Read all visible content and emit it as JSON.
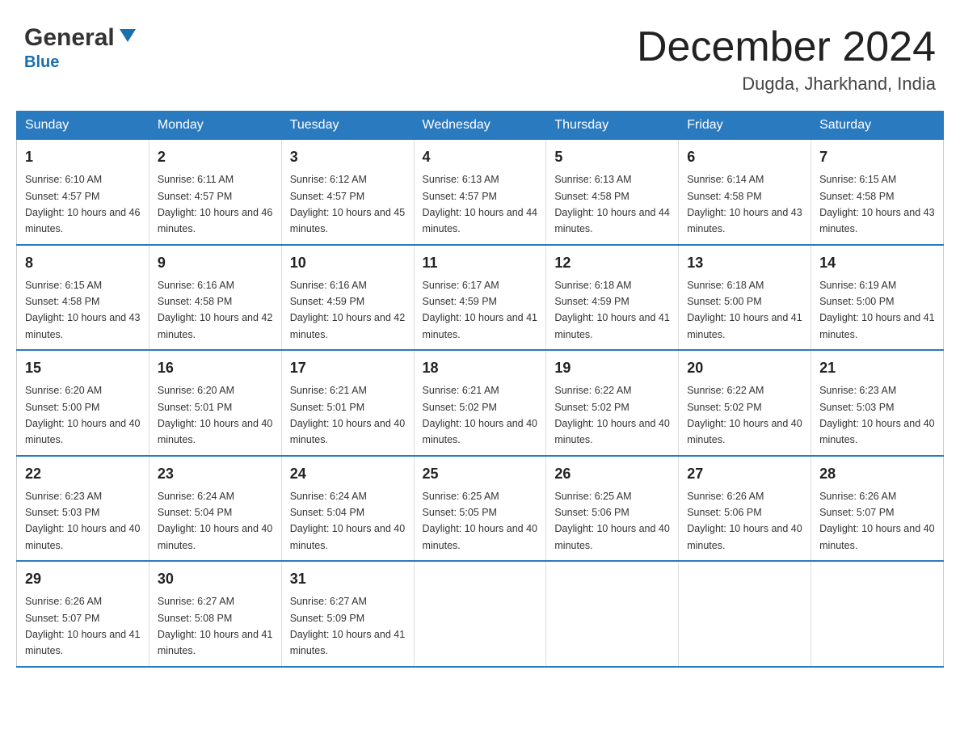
{
  "logo": {
    "general": "General",
    "blue": "Blue"
  },
  "header": {
    "month": "December 2024",
    "location": "Dugda, Jharkhand, India"
  },
  "days_of_week": [
    "Sunday",
    "Monday",
    "Tuesday",
    "Wednesday",
    "Thursday",
    "Friday",
    "Saturday"
  ],
  "weeks": [
    [
      {
        "day": "1",
        "sunrise": "Sunrise: 6:10 AM",
        "sunset": "Sunset: 4:57 PM",
        "daylight": "Daylight: 10 hours and 46 minutes."
      },
      {
        "day": "2",
        "sunrise": "Sunrise: 6:11 AM",
        "sunset": "Sunset: 4:57 PM",
        "daylight": "Daylight: 10 hours and 46 minutes."
      },
      {
        "day": "3",
        "sunrise": "Sunrise: 6:12 AM",
        "sunset": "Sunset: 4:57 PM",
        "daylight": "Daylight: 10 hours and 45 minutes."
      },
      {
        "day": "4",
        "sunrise": "Sunrise: 6:13 AM",
        "sunset": "Sunset: 4:57 PM",
        "daylight": "Daylight: 10 hours and 44 minutes."
      },
      {
        "day": "5",
        "sunrise": "Sunrise: 6:13 AM",
        "sunset": "Sunset: 4:58 PM",
        "daylight": "Daylight: 10 hours and 44 minutes."
      },
      {
        "day": "6",
        "sunrise": "Sunrise: 6:14 AM",
        "sunset": "Sunset: 4:58 PM",
        "daylight": "Daylight: 10 hours and 43 minutes."
      },
      {
        "day": "7",
        "sunrise": "Sunrise: 6:15 AM",
        "sunset": "Sunset: 4:58 PM",
        "daylight": "Daylight: 10 hours and 43 minutes."
      }
    ],
    [
      {
        "day": "8",
        "sunrise": "Sunrise: 6:15 AM",
        "sunset": "Sunset: 4:58 PM",
        "daylight": "Daylight: 10 hours and 43 minutes."
      },
      {
        "day": "9",
        "sunrise": "Sunrise: 6:16 AM",
        "sunset": "Sunset: 4:58 PM",
        "daylight": "Daylight: 10 hours and 42 minutes."
      },
      {
        "day": "10",
        "sunrise": "Sunrise: 6:16 AM",
        "sunset": "Sunset: 4:59 PM",
        "daylight": "Daylight: 10 hours and 42 minutes."
      },
      {
        "day": "11",
        "sunrise": "Sunrise: 6:17 AM",
        "sunset": "Sunset: 4:59 PM",
        "daylight": "Daylight: 10 hours and 41 minutes."
      },
      {
        "day": "12",
        "sunrise": "Sunrise: 6:18 AM",
        "sunset": "Sunset: 4:59 PM",
        "daylight": "Daylight: 10 hours and 41 minutes."
      },
      {
        "day": "13",
        "sunrise": "Sunrise: 6:18 AM",
        "sunset": "Sunset: 5:00 PM",
        "daylight": "Daylight: 10 hours and 41 minutes."
      },
      {
        "day": "14",
        "sunrise": "Sunrise: 6:19 AM",
        "sunset": "Sunset: 5:00 PM",
        "daylight": "Daylight: 10 hours and 41 minutes."
      }
    ],
    [
      {
        "day": "15",
        "sunrise": "Sunrise: 6:20 AM",
        "sunset": "Sunset: 5:00 PM",
        "daylight": "Daylight: 10 hours and 40 minutes."
      },
      {
        "day": "16",
        "sunrise": "Sunrise: 6:20 AM",
        "sunset": "Sunset: 5:01 PM",
        "daylight": "Daylight: 10 hours and 40 minutes."
      },
      {
        "day": "17",
        "sunrise": "Sunrise: 6:21 AM",
        "sunset": "Sunset: 5:01 PM",
        "daylight": "Daylight: 10 hours and 40 minutes."
      },
      {
        "day": "18",
        "sunrise": "Sunrise: 6:21 AM",
        "sunset": "Sunset: 5:02 PM",
        "daylight": "Daylight: 10 hours and 40 minutes."
      },
      {
        "day": "19",
        "sunrise": "Sunrise: 6:22 AM",
        "sunset": "Sunset: 5:02 PM",
        "daylight": "Daylight: 10 hours and 40 minutes."
      },
      {
        "day": "20",
        "sunrise": "Sunrise: 6:22 AM",
        "sunset": "Sunset: 5:02 PM",
        "daylight": "Daylight: 10 hours and 40 minutes."
      },
      {
        "day": "21",
        "sunrise": "Sunrise: 6:23 AM",
        "sunset": "Sunset: 5:03 PM",
        "daylight": "Daylight: 10 hours and 40 minutes."
      }
    ],
    [
      {
        "day": "22",
        "sunrise": "Sunrise: 6:23 AM",
        "sunset": "Sunset: 5:03 PM",
        "daylight": "Daylight: 10 hours and 40 minutes."
      },
      {
        "day": "23",
        "sunrise": "Sunrise: 6:24 AM",
        "sunset": "Sunset: 5:04 PM",
        "daylight": "Daylight: 10 hours and 40 minutes."
      },
      {
        "day": "24",
        "sunrise": "Sunrise: 6:24 AM",
        "sunset": "Sunset: 5:04 PM",
        "daylight": "Daylight: 10 hours and 40 minutes."
      },
      {
        "day": "25",
        "sunrise": "Sunrise: 6:25 AM",
        "sunset": "Sunset: 5:05 PM",
        "daylight": "Daylight: 10 hours and 40 minutes."
      },
      {
        "day": "26",
        "sunrise": "Sunrise: 6:25 AM",
        "sunset": "Sunset: 5:06 PM",
        "daylight": "Daylight: 10 hours and 40 minutes."
      },
      {
        "day": "27",
        "sunrise": "Sunrise: 6:26 AM",
        "sunset": "Sunset: 5:06 PM",
        "daylight": "Daylight: 10 hours and 40 minutes."
      },
      {
        "day": "28",
        "sunrise": "Sunrise: 6:26 AM",
        "sunset": "Sunset: 5:07 PM",
        "daylight": "Daylight: 10 hours and 40 minutes."
      }
    ],
    [
      {
        "day": "29",
        "sunrise": "Sunrise: 6:26 AM",
        "sunset": "Sunset: 5:07 PM",
        "daylight": "Daylight: 10 hours and 41 minutes."
      },
      {
        "day": "30",
        "sunrise": "Sunrise: 6:27 AM",
        "sunset": "Sunset: 5:08 PM",
        "daylight": "Daylight: 10 hours and 41 minutes."
      },
      {
        "day": "31",
        "sunrise": "Sunrise: 6:27 AM",
        "sunset": "Sunset: 5:09 PM",
        "daylight": "Daylight: 10 hours and 41 minutes."
      },
      null,
      null,
      null,
      null
    ]
  ]
}
